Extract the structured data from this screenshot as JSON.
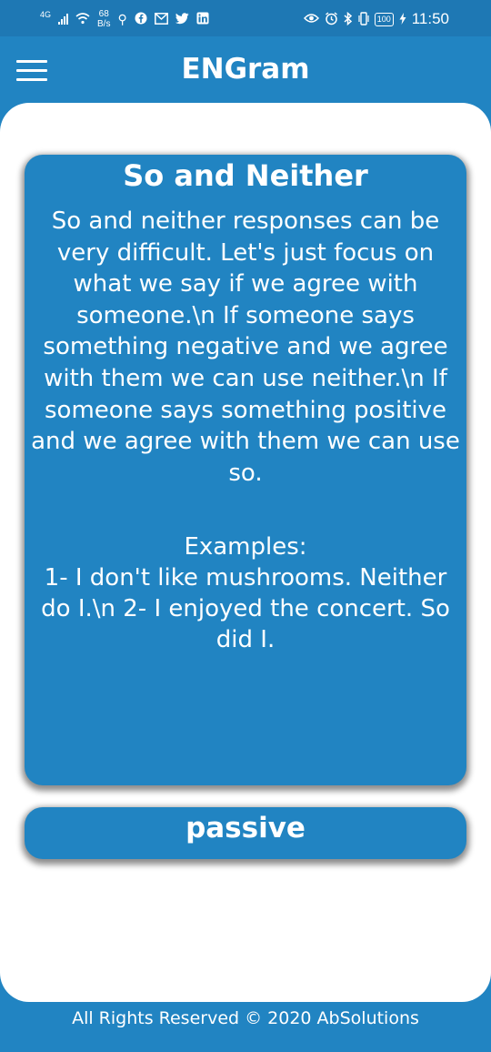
{
  "status_bar": {
    "network": "4G",
    "speed_value": "68",
    "speed_unit": "B/s",
    "battery": "100",
    "time": "11:50",
    "icons_left": [
      "usb-icon",
      "facebook-icon",
      "gmail-icon",
      "twitter-icon",
      "linkedin-icon"
    ],
    "icons_right": [
      "eye-icon",
      "alarm-icon",
      "bluetooth-icon",
      "vibrate-icon",
      "battery-icon",
      "charging-icon"
    ]
  },
  "app_bar": {
    "title": "ENGram",
    "menu_icon": "hamburger-menu-icon"
  },
  "lesson": {
    "title": "So and Neither",
    "body": "So and neither responses can be very difficult. Let's just focus on what we say if we agree with someone.\\n If someone says something negative and we agree with them we can use neither.\\n If someone says something positive and we agree with them we can use so.",
    "examples_heading": "Examples:",
    "examples_text": "1- I don't like mushrooms. Neither do I.\\n  2- I enjoyed the concert. So did I."
  },
  "next_topic": {
    "label": "passive"
  },
  "footer": {
    "text": "All Rights Reserved © 2020 AbSolutions"
  },
  "colors": {
    "primary": "#2184c2",
    "status_bar": "#1e78b4",
    "surface": "#ffffff",
    "text_on_primary": "#ffffff"
  }
}
